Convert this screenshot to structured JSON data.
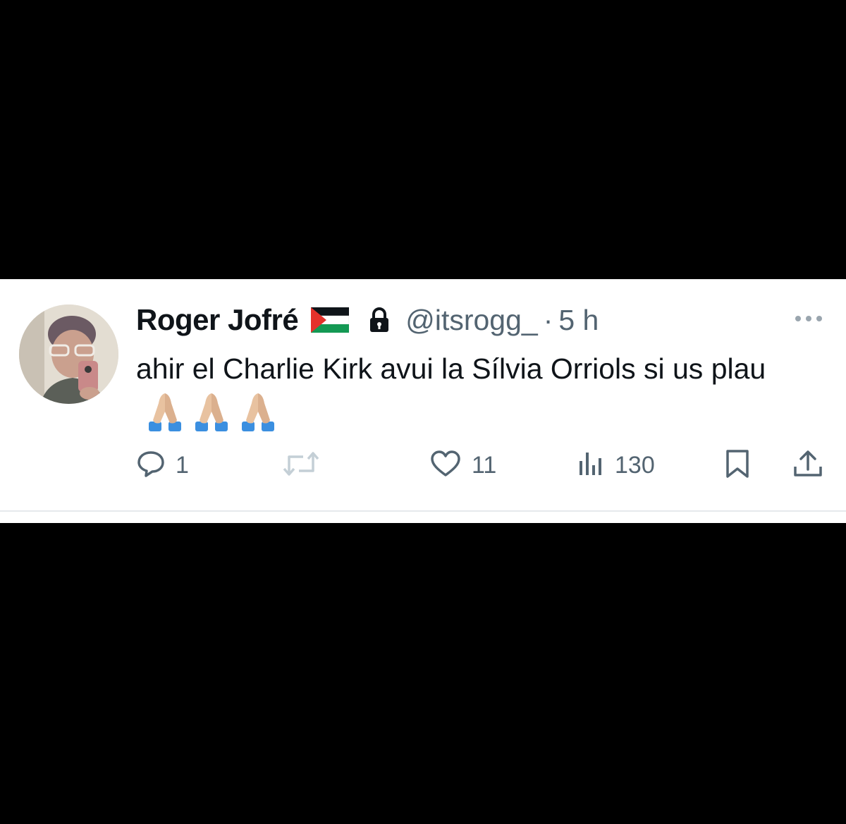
{
  "tweet": {
    "author": {
      "display_name": "Roger Jofré",
      "flag_icon": "palestine-flag-icon",
      "protected_icon": "lock-icon",
      "handle": "@itsrogg_",
      "separator": "·",
      "time": "5 h"
    },
    "text": "ahir el Charlie Kirk avui la Sílvia Orriols si us plau",
    "emojis": [
      "🙏🏼",
      "🙏🏼",
      "🙏🏼"
    ],
    "actions": {
      "reply": {
        "icon": "reply-icon",
        "count": "1"
      },
      "retweet": {
        "icon": "retweet-icon",
        "count": ""
      },
      "like": {
        "icon": "heart-icon",
        "count": "11"
      },
      "views": {
        "icon": "views-icon",
        "count": "130"
      },
      "bookmark": {
        "icon": "bookmark-icon"
      },
      "share": {
        "icon": "share-icon"
      }
    },
    "more_icon": "more-icon"
  },
  "colors": {
    "background": "#000000",
    "card": "#ffffff",
    "text_primary": "#0f1419",
    "text_secondary": "#536471",
    "divider": "#e6e9ec",
    "flag_red": "#e4312b",
    "flag_green": "#149954",
    "retweet_icon_muted": "#c4cfd6"
  }
}
